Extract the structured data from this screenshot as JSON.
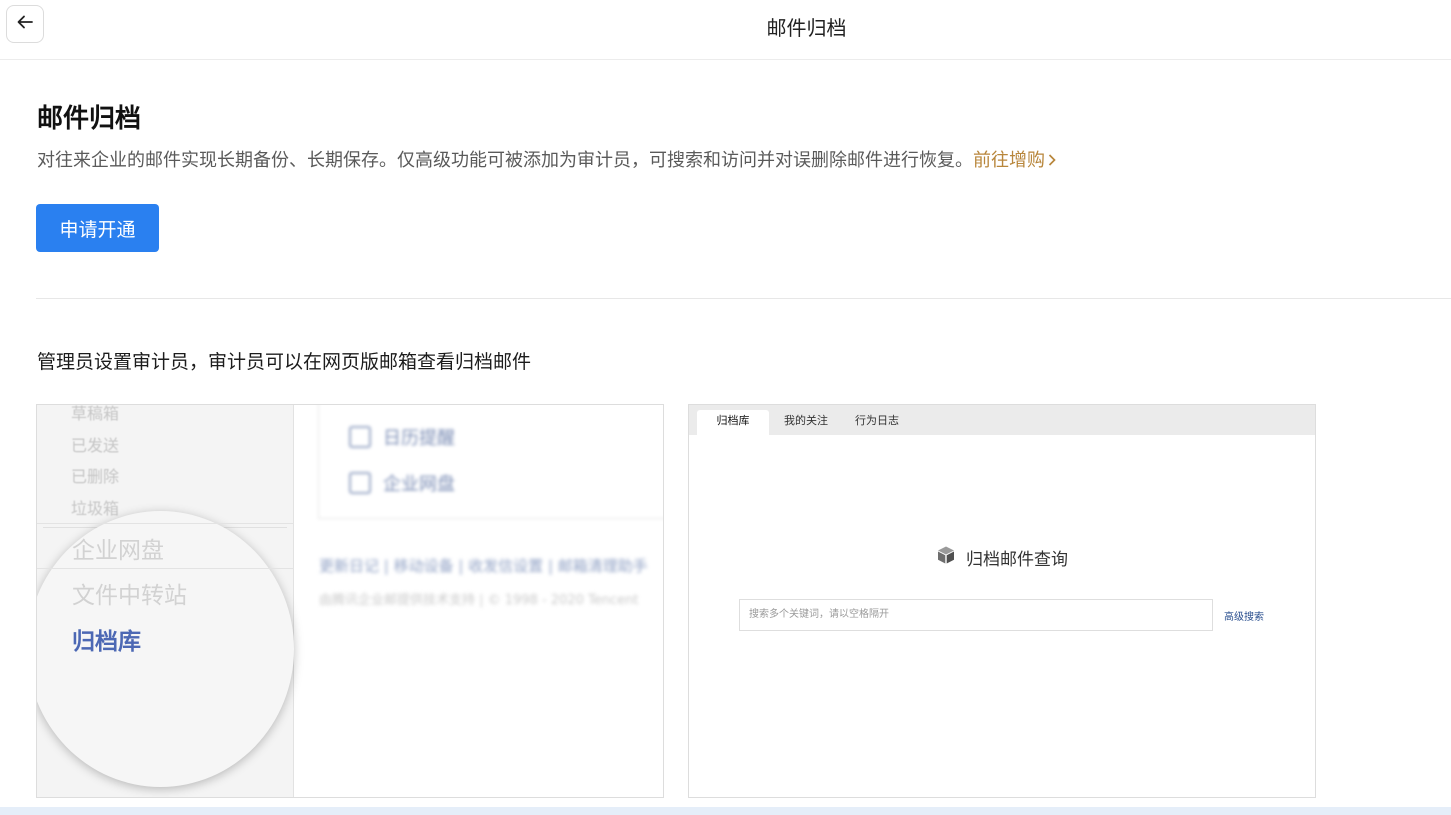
{
  "topbar": {
    "back_icon": "arrow-left-icon",
    "title": "邮件归档"
  },
  "main": {
    "heading": "邮件归档",
    "description": "对往来企业的邮件实现长期备份、长期保存。仅高级功能可被添加为审计员，可搜索和访问并对误删除邮件进行恢复。",
    "upgrade_link": "前往增购",
    "apply_button": "申请开通",
    "subtitle": "管理员设置审计员，审计员可以在网页版邮箱查看归档邮件",
    "accent_color": "#2a80f0",
    "link_color": "#b8863b"
  },
  "preview_left": {
    "sidebar_items": [
      "草稿箱",
      "已发送",
      "已删除",
      "垃圾箱"
    ],
    "card_items": [
      "日历提醒",
      "企业网盘"
    ],
    "footer_links": "更新日记 | 移动设备 | 收发信设置 | 邮箱清理助手",
    "footer_copy": "由腾讯企业邮提供技术支持 | © 1998 - 2020 Tencent",
    "magnified_items": [
      "企业网盘",
      "文件中转站",
      "归档库"
    ],
    "magnified_active": "归档库"
  },
  "preview_right": {
    "tabs": [
      "归档库",
      "我的关注",
      "行为日志"
    ],
    "active_tab": "归档库",
    "query_title": "归档邮件查询",
    "search_placeholder": "搜索多个关键词，请以空格隔开",
    "advanced_search": "高级搜索"
  }
}
